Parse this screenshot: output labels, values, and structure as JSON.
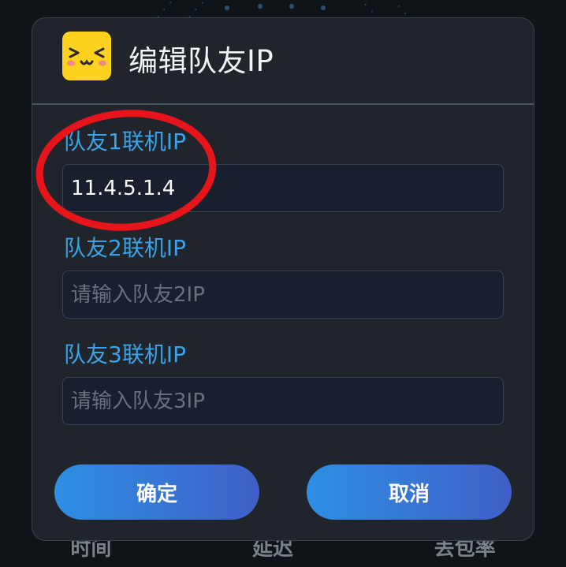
{
  "dialog": {
    "title": "编辑队友IP",
    "logo_icon": "smiley-face-icon"
  },
  "fields": [
    {
      "label": "队友1联机IP",
      "value": "11.4.5.1.4",
      "placeholder": ""
    },
    {
      "label": "队友2联机IP",
      "value": "",
      "placeholder": "请输入队友2IP"
    },
    {
      "label": "队友3联机IP",
      "value": "",
      "placeholder": "请输入队友3IP"
    }
  ],
  "buttons": {
    "confirm": "确定",
    "cancel": "取消"
  },
  "background_stats": [
    "时间",
    "延迟",
    "丢包率"
  ],
  "colors": {
    "accent": "#3ba2e8",
    "logo": "#ffd21f",
    "annotation": "#e8141c",
    "button_start": "#2f8fe5",
    "button_end": "#3f5fc6"
  }
}
